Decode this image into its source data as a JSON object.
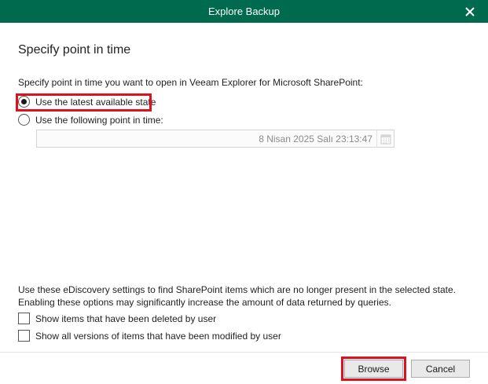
{
  "window": {
    "title": "Explore Backup",
    "close_icon": "close-icon",
    "titlebar_color": "#006a4e"
  },
  "page": {
    "heading": "Specify point in time",
    "intro": "Specify point in time you want to open in Veeam Explorer for Microsoft SharePoint:"
  },
  "options": {
    "latest": {
      "label": "Use the latest available state",
      "selected": true
    },
    "point": {
      "label": "Use the following point in time:",
      "selected": false
    }
  },
  "date_field": {
    "value": "8 Nisan 2025 Salı 23:13:47",
    "icon": "calendar-icon",
    "enabled": false
  },
  "ediscovery": {
    "line1": "Use these eDiscovery settings to find SharePoint items which are no longer present in the selected state.",
    "line2": "Enabling these options may significantly increase the amount of data returned by queries.",
    "show_deleted": {
      "label": "Show items that have been deleted by user",
      "checked": false
    },
    "show_versions": {
      "label": "Show all versions of items that have been modified by user",
      "checked": false
    }
  },
  "buttons": {
    "browse": "Browse",
    "cancel": "Cancel"
  },
  "highlight_color": "#e0101e"
}
